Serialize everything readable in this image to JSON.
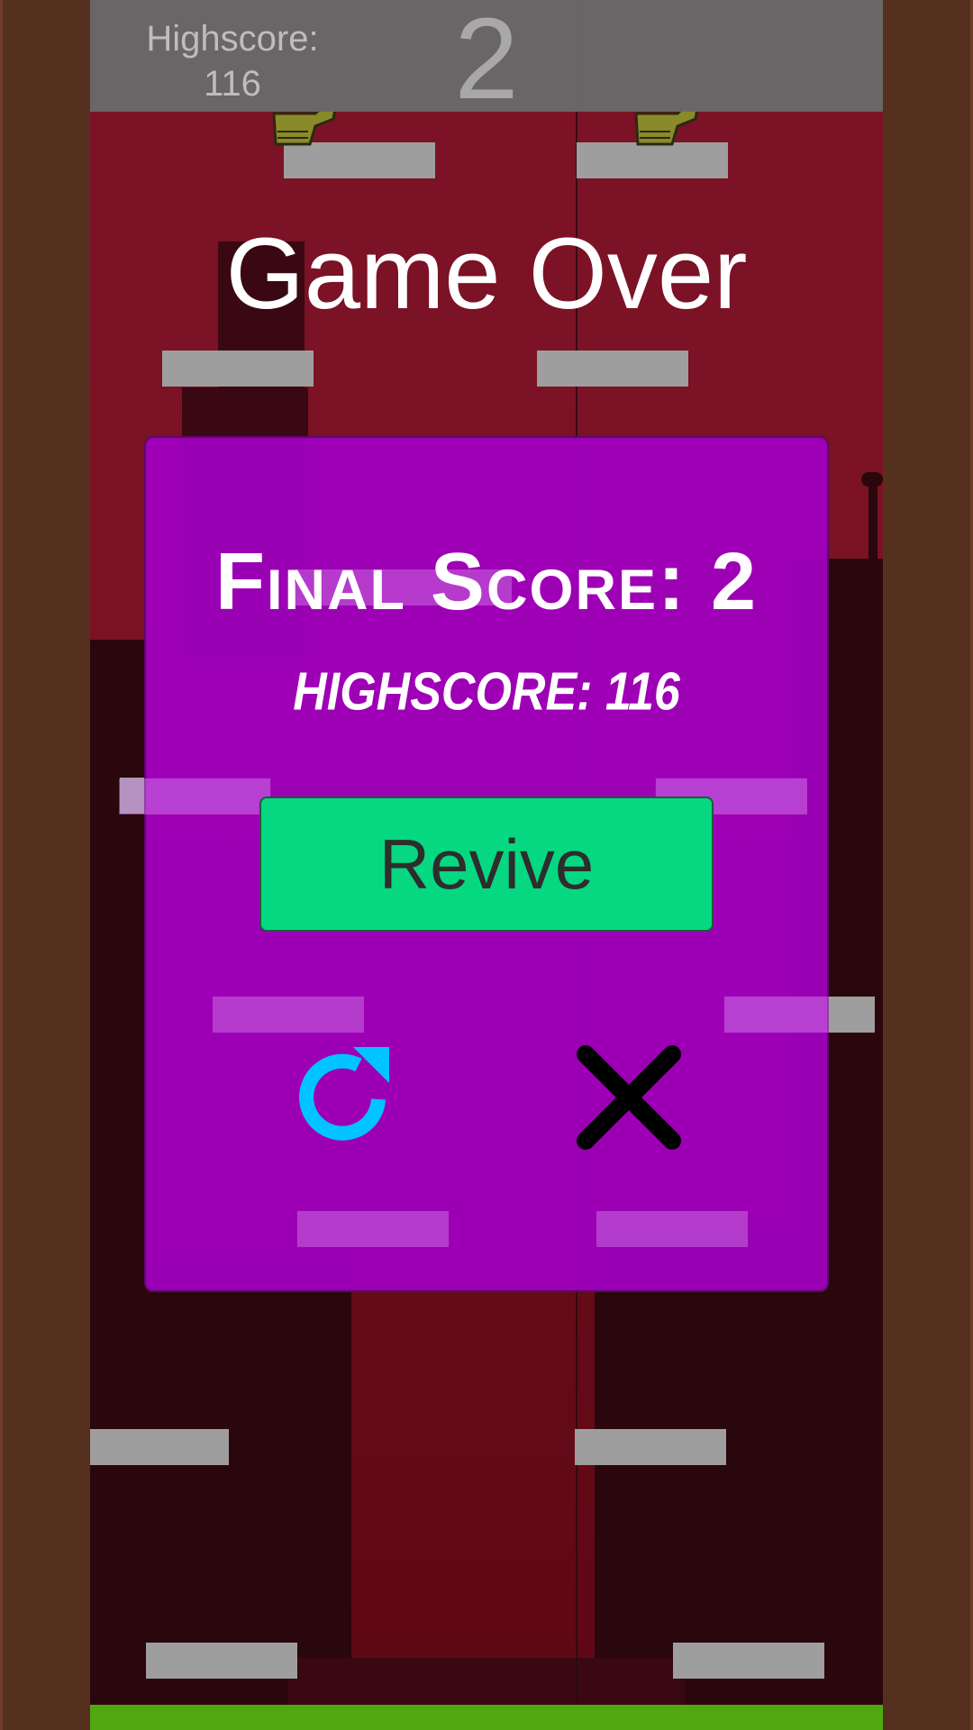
{
  "hud": {
    "highscore_label": "Highscore:",
    "highscore_value": "116",
    "current_score": "2"
  },
  "game_over": {
    "title": "Game Over"
  },
  "modal": {
    "final_score_text": "Final Score: 2",
    "highscore_text": "HIGHSCORE: 116",
    "revive_label": "Revive",
    "restart_icon": "restart-icon",
    "close_icon": "close-icon"
  },
  "colors": {
    "wall": "#56301f",
    "sky": "#7c1226",
    "modal": "#a000be",
    "revive": "#06d882",
    "restart_icon": "#00c4ff",
    "close_icon": "#000000",
    "platform": "#9e9e9e",
    "ground": "#4fa80f"
  }
}
